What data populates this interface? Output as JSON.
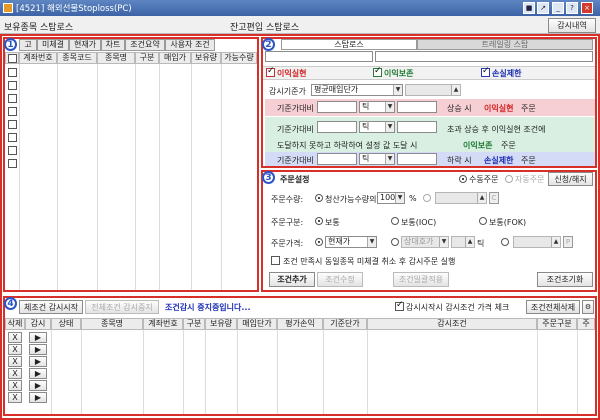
{
  "window": {
    "title": "[4521] 해외선물Stoploss(PC)"
  },
  "header": {
    "title": "보유종목 스탑로스",
    "subtitle": "잔고편입 스탑로스",
    "history_button": "감시내역"
  },
  "panel1": {
    "badge": "1",
    "tabs": [
      "고",
      "미체결",
      "현재가",
      "차트",
      "조건요약",
      "사용자 조건"
    ],
    "columns": [
      "계좌번호",
      "종목코드",
      "종목명",
      "구분",
      "매입가",
      "보유량",
      "가능수량"
    ]
  },
  "panel2": {
    "badge": "2",
    "tabs": [
      "스탑로스",
      "트레일링 스탑"
    ],
    "profit_check": "이익실현",
    "breakeven_check": "이익보존",
    "loss_check": "손실제한",
    "basis_label": "감시기준가",
    "basis_value": "평균매입단가",
    "row1": {
      "label": "기준가대비",
      "unit": "틱",
      "suffix": "상승 시",
      "keyword": "이익실현",
      "tail": "주문"
    },
    "row2": {
      "label": "기준가대비",
      "unit": "틱",
      "suffix": "초과 상승 후 이익실현 조건에"
    },
    "row3": {
      "label": "도달하지 못하고 하락하여 설정 값 도달 시",
      "keyword": "이익보존",
      "tail": "주문"
    },
    "row4": {
      "label": "기준가대비",
      "unit": "틱",
      "suffix": "하락 시",
      "keyword": "손실제한",
      "tail": "주문"
    }
  },
  "panel3": {
    "badge": "3",
    "title": "주문설정",
    "manual_order": "수동주문",
    "auto_order": "자동주문",
    "apply_button": "신청/해지",
    "qty_label": "주문수량:",
    "qty_option": "청산가능수량의",
    "qty_value": "100",
    "qty_unit": "%",
    "type_label": "주문구분:",
    "type_options": [
      "보통",
      "보통(IOC)",
      "보통(FOK)"
    ],
    "price_label": "주문가격:",
    "price_value": "현재가",
    "price_alt": "상대호가",
    "price_tick": "틱",
    "price_p": "P",
    "cancel_check": "조건 만족시 동일종목 미체결 취소 후 감시주문 실행",
    "add_button": "조건추가",
    "edit_button": "조건수정",
    "batch_button": "조건일괄적용",
    "reset_button": "조건초기화"
  },
  "panel4": {
    "badge": "4",
    "start_button": "체조건 감시시작",
    "stop_all_button": "전체조건 감시중지",
    "status": "조건감시 중지중입니다...",
    "price_check": "감시시작시 감시조건 가격 체크",
    "delete_all_button": "조건전체삭제",
    "columns": [
      "삭제",
      "감시",
      "상태",
      "종목명",
      "계좌번호",
      "구분",
      "보유량",
      "매입단가",
      "평가손익",
      "기준단가",
      "감시조건",
      "주문구분",
      "주"
    ],
    "delete_mark": "X",
    "play_mark": "▶"
  },
  "colors": {
    "accent": "#d83028",
    "badge": "#2a55c8",
    "profit": "#d22323",
    "breakeven": "#1f7a33",
    "loss": "#1d2fb5"
  }
}
